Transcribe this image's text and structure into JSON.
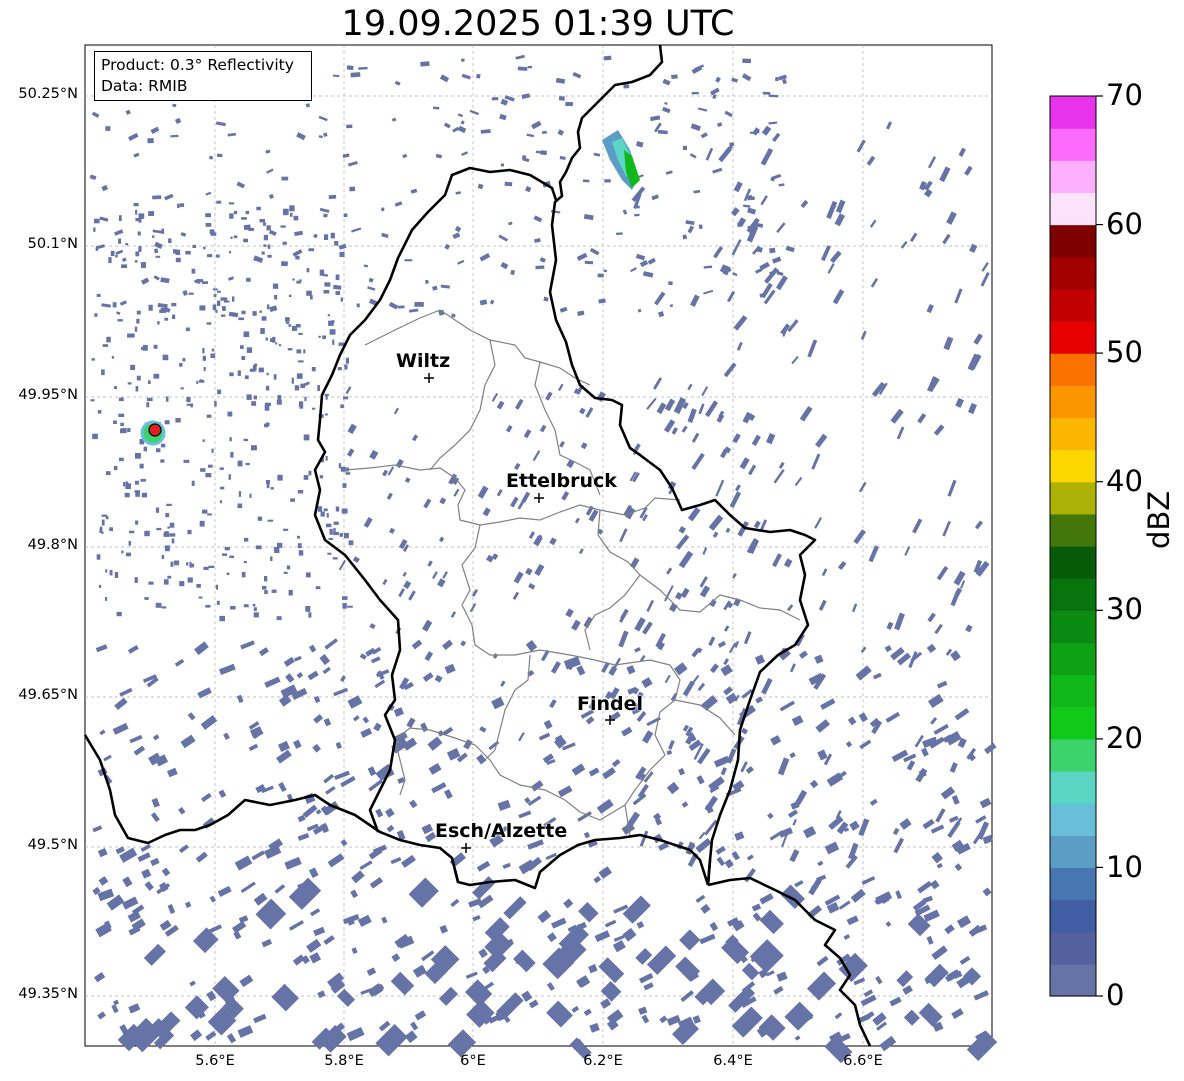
{
  "title": "19.09.2025 01:39 UTC",
  "info_box": {
    "product": "Product: 0.3° Reflectivity",
    "data": "Data: RMIB"
  },
  "lat_labels": [
    "50.25°N",
    "50.1°N",
    "49.95°N",
    "49.8°N",
    "49.65°N",
    "49.5°N",
    "49.35°N"
  ],
  "lon_labels": [
    "5.6°E",
    "5.8°E",
    "6°E",
    "6.2°E",
    "6.4°E",
    "6.6°E"
  ],
  "cities": [
    {
      "name": "Wiltz"
    },
    {
      "name": "Ettelbruck"
    },
    {
      "name": "Findel"
    },
    {
      "name": "Esch/Alzette"
    }
  ],
  "colorbar": {
    "label": "dBZ",
    "ticks": [
      "0",
      "10",
      "20",
      "30",
      "40",
      "50",
      "60",
      "70"
    ],
    "range": [
      0,
      70
    ],
    "colors": [
      "#6573a7",
      "#53619e",
      "#415da3",
      "#4876b1",
      "#5b9dc4",
      "#67c0d7",
      "#5cd6c4",
      "#3cd26c",
      "#10c919",
      "#10b81a",
      "#0ea115",
      "#0a8a12",
      "#08740e",
      "#075b08",
      "#44770a",
      "#adb206",
      "#fcd700",
      "#fcb600",
      "#fc9600",
      "#fb7200",
      "#e60000",
      "#c30000",
      "#a20000",
      "#7f0000",
      "#fde2fb",
      "#fcaffc",
      "#fc6bfc",
      "#e833ec"
    ]
  },
  "map": {
    "extent_lon": [
      5.4,
      6.8
    ],
    "extent_lat": [
      49.32,
      50.29
    ],
    "grid": true,
    "radar_site_color": "#e02020"
  }
}
